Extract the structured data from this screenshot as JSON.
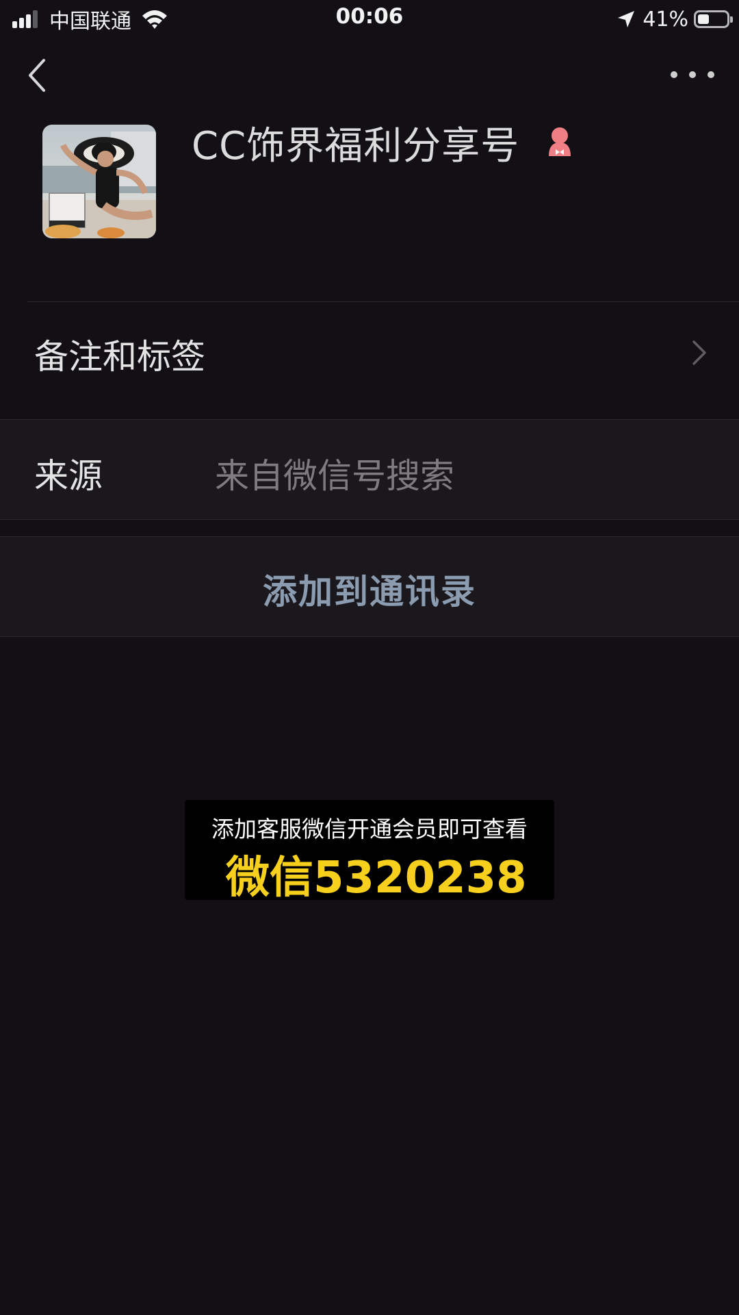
{
  "status_bar": {
    "carrier": "中国联通",
    "time": "00:06",
    "battery_percent": "41%",
    "battery_level": 0.41,
    "signal_bars_active": 3,
    "signal_bars_total": 4
  },
  "nav": {
    "back_icon": "chevron-left-icon",
    "more_icon": "more-dots-icon"
  },
  "profile": {
    "name": "CC饰界福利分享号",
    "gender_icon": "female-icon",
    "gender_color": "#f07f85"
  },
  "rows": {
    "remark_label": "备注和标签",
    "source_label": "来源",
    "source_value": "来自微信号搜索",
    "add_contact_label": "添加到通讯录"
  },
  "promo": {
    "line1": "添加客服微信开通会员即可查看",
    "line2": "微信5320238",
    "accent_color": "#f7cf1d"
  },
  "colors": {
    "background": "#131015",
    "row_background": "#1b181d",
    "link_text": "#8b9bb0"
  }
}
